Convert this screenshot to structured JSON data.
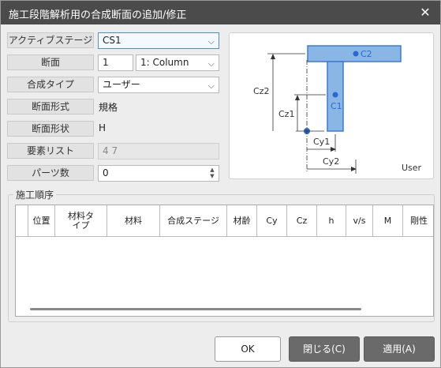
{
  "window": {
    "title": "施工段階解析用の合成断面の追加/修正",
    "close_icon": "close-icon"
  },
  "form": {
    "active_stage": {
      "label": "アクティブステージ",
      "value": "CS1"
    },
    "section": {
      "label": "断面",
      "value": "1",
      "select_value": "1: Column"
    },
    "composite_type": {
      "label": "合成タイプ",
      "value": "ユーザー"
    },
    "section_shape": {
      "label": "断面形式",
      "value": "規格"
    },
    "section_form": {
      "label": "断面形状",
      "value": "H"
    },
    "element_list": {
      "label": "要素リスト",
      "value": "4 7"
    },
    "parts_count": {
      "label": "パーツ数",
      "value": "0"
    }
  },
  "diagram": {
    "c1": "C1",
    "c2": "C2",
    "cz1": "Cz1",
    "cz2": "Cz2",
    "cy1": "Cy1",
    "cy2": "Cy2",
    "mode": "User",
    "fill_color": "#8ab6e6",
    "stroke_color": "#3a7bd5"
  },
  "construction": {
    "group_title": "施工順序",
    "columns": [
      "位置",
      "材料タイプ",
      "材料",
      "合成ステージ",
      "材齢",
      "Cy",
      "Cz",
      "h",
      "v/s",
      "M",
      "剛性"
    ]
  },
  "buttons": {
    "ok": "OK",
    "close": "閉じる(C)",
    "apply": "適用(A)"
  }
}
